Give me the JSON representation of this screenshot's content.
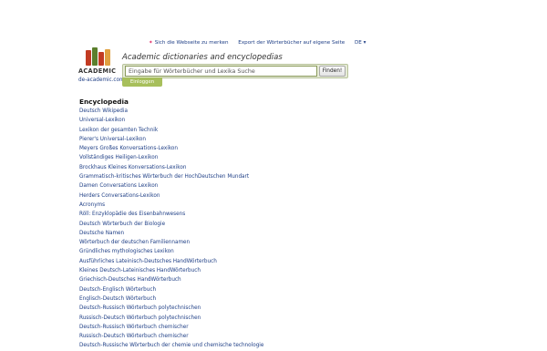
{
  "topbar": {
    "bookmark": "Sich die Webseite zu merken",
    "export": "Export der Wörterbücher auf eigene Seite",
    "lang": "DE"
  },
  "logo": {
    "brand": "ACADEMIC",
    "domain": "de-academic.com",
    "book_colors": [
      "#c23b22",
      "#5b7f2d",
      "#c23b22",
      "#e0a040"
    ]
  },
  "tagline": "Academic dictionaries and encyclopedias",
  "search": {
    "placeholder": "Eingabe für Wörterbücher und Lexika Suche",
    "find_label": "Finden!",
    "extra_label": "Einloggen"
  },
  "section": {
    "title": "Encyclopedia",
    "items": [
      "Deutsch Wikipedia",
      "Universal-Lexikon",
      "Lexikon der gesamten Technik",
      "Pierer's Universal-Lexikon",
      "Meyers Großes Konversations-Lexikon",
      "Vollständiges Heiligen-Lexikon",
      "Brockhaus Kleines Konversations-Lexikon",
      "Grammatisch-kritisches Wörterbuch der HochDeutschen Mundart",
      "Damen Conversations Lexikon",
      "Herders Conversations-Lexikon",
      "Acronyms",
      "Röll: Enzyklopädie des Eisenbahnwesens",
      "Deutsch Wörterbuch der Biologie",
      "Deutsche Namen",
      "Wörterbuch der deutschen Familiennamen",
      "Gründliches mythologisches Lexikon",
      "Ausführliches Lateinisch-Deutsches HandWörterbuch",
      "Kleines Deutsch-Lateinisches HandWörterbuch",
      "Griechisch-Deutsches HandWörterbuch",
      "Deutsch-Englisch Wörterbuch",
      "Englisch-Deutsch Wörterbuch",
      "Deutsch-Russisch Wörterbuch polytechnischen",
      "Russisch-Deutsch Wörterbuch polytechnischen",
      "Deutsch-Russisch Wörterbuch chemischer",
      "Russisch-Deutsch Wörterbuch chemischer",
      "Deutsch-Russische Wörterbuch der chemie und chemische technologie"
    ]
  }
}
